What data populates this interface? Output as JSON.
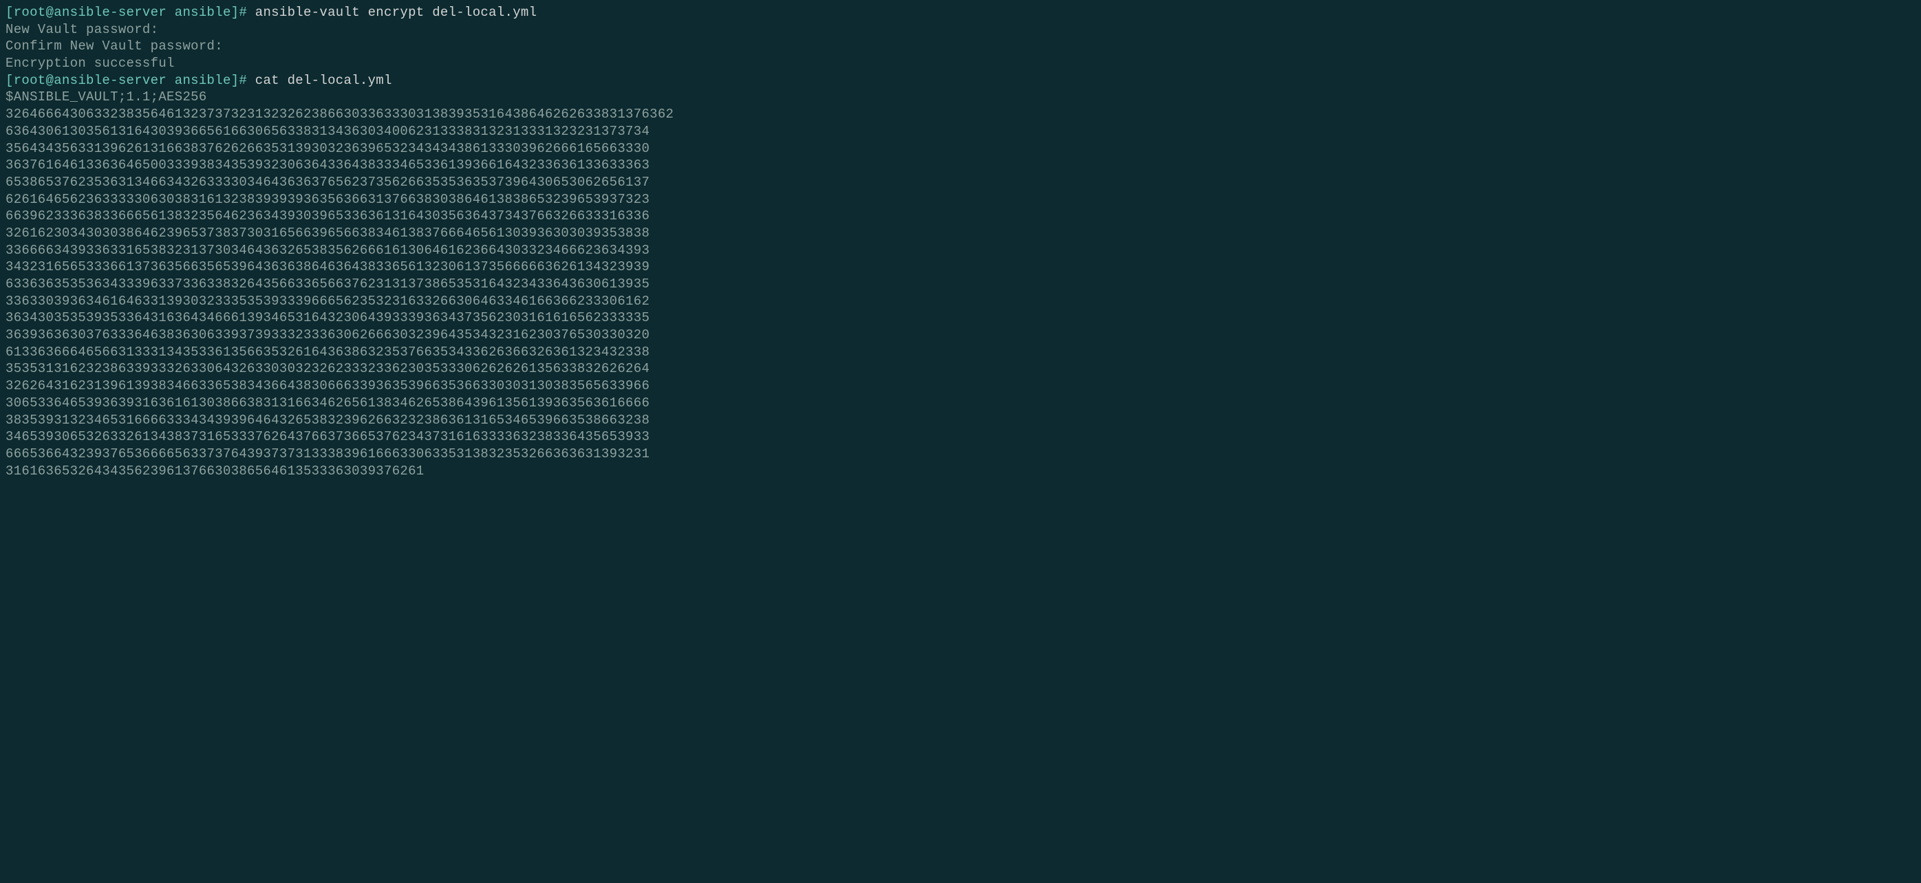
{
  "terminal": {
    "prompt": "[root@ansible-server ansible]# ",
    "lines": [
      {
        "type": "prompt-cmd",
        "prompt": "[root@ansible-server ansible]# ",
        "cmd": "ansible-vault encrypt del-local.yml"
      },
      {
        "type": "output",
        "text": "New Vault password:"
      },
      {
        "type": "output",
        "text": "Confirm New Vault password:"
      },
      {
        "type": "output",
        "text": "Encryption successful"
      },
      {
        "type": "prompt-cmd",
        "prompt": "[root@ansible-server ansible]# ",
        "cmd": "cat del-local.yml"
      },
      {
        "type": "output",
        "text": "$ANSIBLE_VAULT;1.1;AES256"
      },
      {
        "type": "output",
        "text": "32646664306332383564613237373231323262386630336333031383935316438646262633831376362"
      },
      {
        "type": "output",
        "text": "63643061303561316430393665616630656338313436303400623133383132313331323231373734"
      },
      {
        "type": "output",
        "text": "35643435633139626131663837626266353139303236396532343434386133303962666165663330"
      },
      {
        "type": "output",
        "text": "36376164613363646500333938343539323063643364383334653361393661643233636133633363"
      },
      {
        "type": "output",
        "text": "65386537623536313466343263333034643636376562373562663535363537396430653062656137"
      },
      {
        "type": "output",
        "text": "62616465623633333063038316132383939393635636631376638303864613838653239653937323"
      },
      {
        "type": "output",
        "text": "66396233363833666561383235646236343930396533636131643035636437343766326633316336"
      },
      {
        "type": "output",
        "text": "32616230343030386462396537383730316566396566383461383766646561303936303039353838"
      },
      {
        "type": "output",
        "text": "33666634393363316538323137303464363265383562666161306461623664303323466623634393"
      },
      {
        "type": "output",
        "text": "34323165653336613736356635653964363638646364383365613230613735666663626134323939"
      },
      {
        "type": "output",
        "text": "63363635353634333963373363383264356633656637623131373865353164323433643630613935"
      },
      {
        "type": "output",
        "text": "33633039363461646331393032333535393339666562353231633266306463346166366233306162"
      },
      {
        "type": "output",
        "text": "36343035353935336431636434666139346531643230643933393634373562303161616562333335"
      },
      {
        "type": "output",
        "text": "36393636303763336463836306339373933323336306266630323964353432316230376530330320"
      },
      {
        "type": "output",
        "text": "61336366646566313331343533613566353261643638632353766353433626366326361323432338"
      },
      {
        "type": "output",
        "text": "35353131623238633933326330643263303032326233323362303533306262626135633832626264"
      },
      {
        "type": "output",
        "text": "32626431623139613938346633653834366438306663393635396635366330303130383565633966"
      },
      {
        "type": "output",
        "text": "30653364653936393163616130386638313166346265613834626538643961356139363563616666"
      },
      {
        "type": "output",
        "text": "38353931323465316666333434393964643265383239626632323863613165346539663538663238"
      },
      {
        "type": "output",
        "text": "34653930653263326134383731653337626437663736653762343731616333363238336435653933"
      },
      {
        "type": "output",
        "text": "66653664323937653666656337376439373731333839616663306335313832353266363631393231"
      },
      {
        "type": "output",
        "text": "3161636532643435623961376630386564613533363039376261"
      }
    ]
  }
}
